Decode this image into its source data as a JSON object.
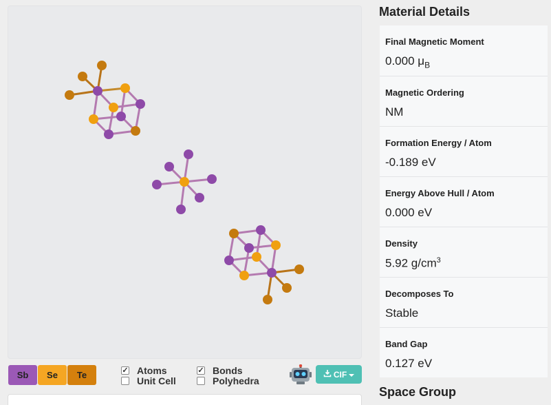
{
  "viewer": {
    "legend": [
      {
        "symbol": "Sb",
        "color": "#9b59b6"
      },
      {
        "symbol": "Se",
        "color": "#f5a623"
      },
      {
        "symbol": "Te",
        "color": "#d4800d"
      }
    ],
    "checkboxes": [
      {
        "label": "Atoms",
        "checked": true
      },
      {
        "label": "Unit Cell",
        "checked": false
      },
      {
        "label": "Bonds",
        "checked": true
      },
      {
        "label": "Polyhedra",
        "checked": false
      }
    ],
    "download_label": "CIF",
    "robot_icon": "robot-icon"
  },
  "details": {
    "title": "Material Details",
    "items": [
      {
        "label": "Final Magnetic Moment",
        "value": "0.000 μ",
        "sub": "B"
      },
      {
        "label": "Magnetic Ordering",
        "value": "NM"
      },
      {
        "label": "Formation Energy / Atom",
        "value": "-0.189 eV"
      },
      {
        "label": "Energy Above Hull / Atom",
        "value": "0.000 eV"
      },
      {
        "label": "Density",
        "value": "5.92 g/cm",
        "sup": "3"
      },
      {
        "label": "Decomposes To",
        "value": "Stable"
      },
      {
        "label": "Band Gap",
        "value": "0.127 eV"
      }
    ]
  },
  "space_group": {
    "title": "Space Group"
  },
  "colors": {
    "sb": "#9b59b6",
    "se": "#f5a623",
    "te": "#d4800d",
    "accent": "#4fc0b4"
  }
}
